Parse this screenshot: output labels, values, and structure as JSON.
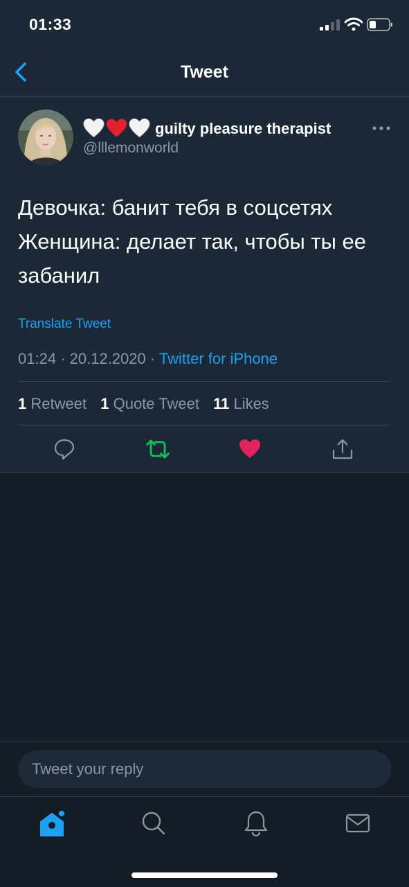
{
  "status_bar": {
    "time": "01:33"
  },
  "nav": {
    "title": "Tweet",
    "back_icon": "chevron-left-icon"
  },
  "author": {
    "emojis": [
      "🤍",
      "❤️",
      "🤍"
    ],
    "name": "guilty pleasure therapist",
    "handle": "@lllemonworld"
  },
  "tweet": {
    "lines": [
      "Девочка: банит тебя в соцсетях",
      "Женщина: делает так, чтобы ты ее",
      "забанил"
    ],
    "translate_label": "Translate Tweet",
    "time": "01:24",
    "date": "20.12.2020",
    "separator": "·",
    "source": "Twitter for iPhone"
  },
  "stats": {
    "retweets_count": "1",
    "retweets_label": "Retweet",
    "quotes_count": "1",
    "quotes_label": "Quote Tweet",
    "likes_count": "11",
    "likes_label": "Likes"
  },
  "actions": {
    "reply_icon": "reply-icon",
    "retweet_icon": "retweet-icon",
    "like_icon": "heart-icon",
    "share_icon": "share-icon"
  },
  "reply": {
    "placeholder": "Tweet your reply"
  },
  "tabs": [
    "home-icon",
    "search-icon",
    "notifications-icon",
    "messages-icon"
  ],
  "colors": {
    "background": "#141d26",
    "surface": "#1b2836",
    "accent": "#1da1f2",
    "retweet_active": "#17bf63",
    "like_active": "#e0245e",
    "muted_text": "#8899a6"
  }
}
